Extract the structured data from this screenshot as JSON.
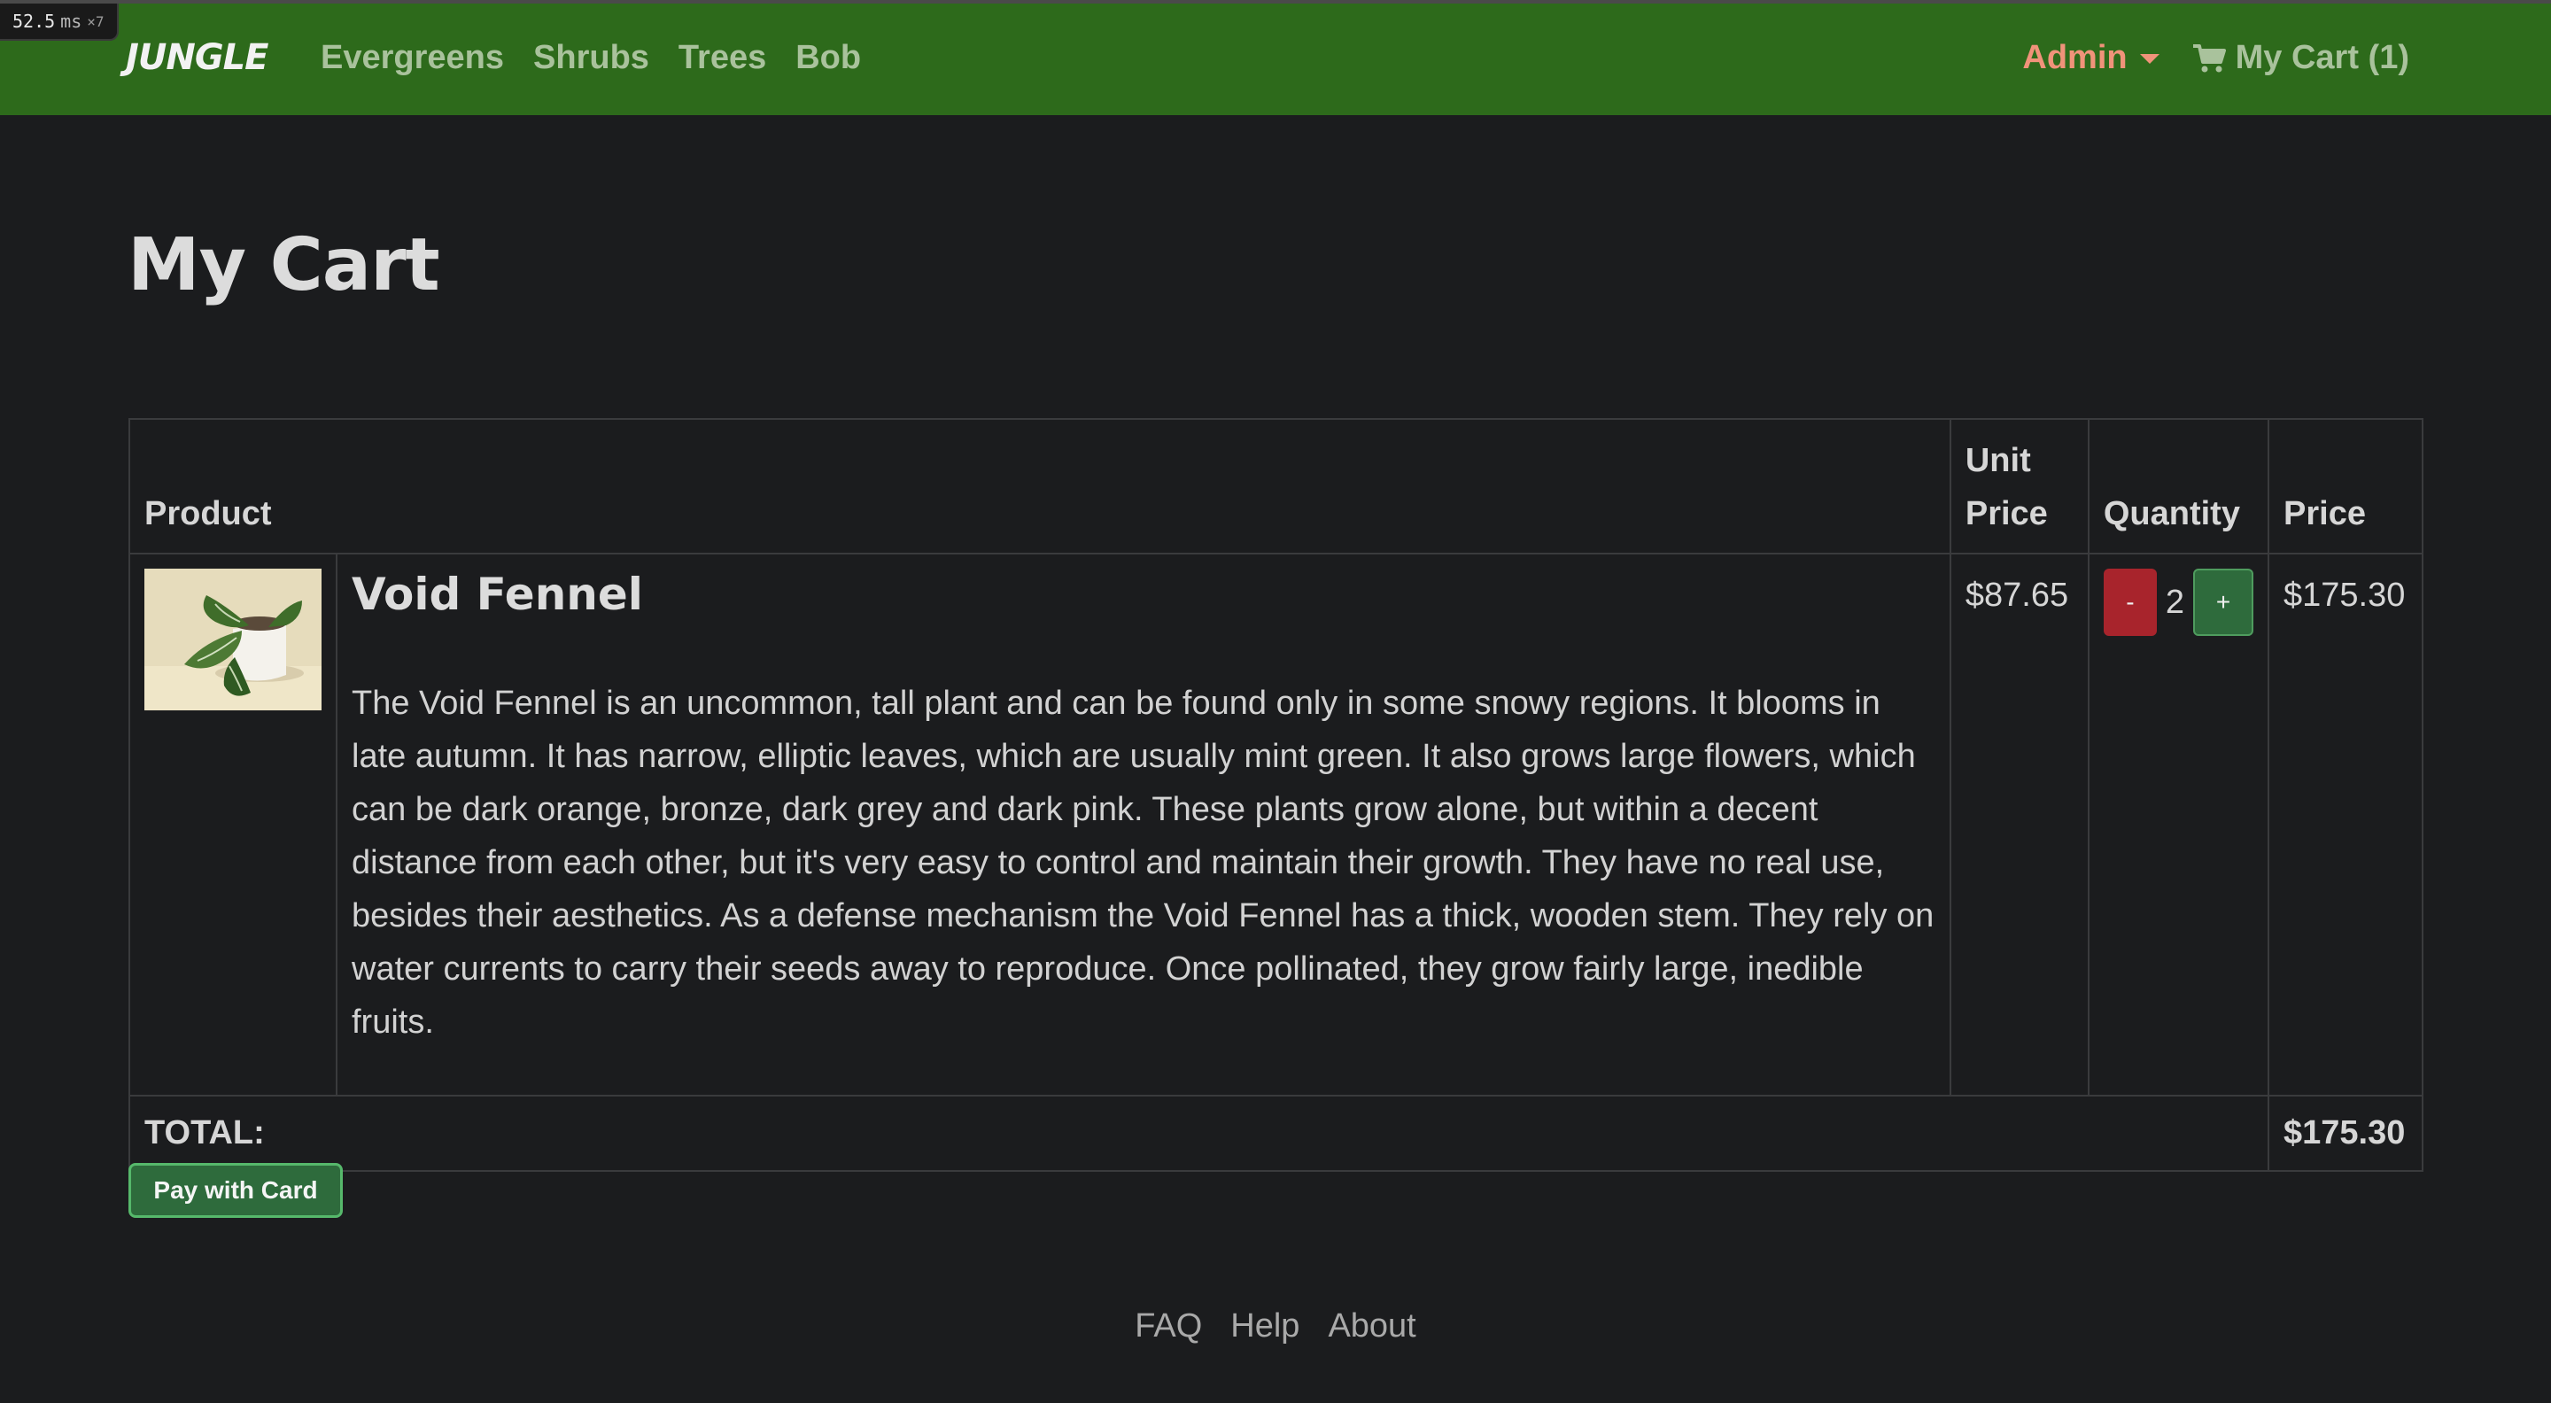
{
  "perf": {
    "value": "52.5",
    "unit": "ms",
    "mult": "×7"
  },
  "navbar": {
    "brand": "JUNGLE",
    "links": [
      "Evergreens",
      "Shrubs",
      "Trees",
      "Bob"
    ],
    "admin_label": "Admin",
    "cart_label": "My Cart (1)",
    "icons": {
      "cart": "shopping-cart-icon",
      "caret": "caret-down-icon"
    },
    "colors": {
      "navbar_bg": "#2d6a1b",
      "admin": "#f0937a",
      "link": "#a9c29c"
    }
  },
  "page": {
    "title": "My Cart"
  },
  "table": {
    "headers": {
      "product": "Product",
      "unit_price": "Unit Price",
      "quantity": "Quantity",
      "price": "Price"
    },
    "items": [
      {
        "name": "Void Fennel",
        "description": "The Void Fennel is an uncommon, tall plant and can be found only in some snowy regions. It blooms in late autumn. It has narrow, elliptic leaves, which are usually mint green. It also grows large flowers, which can be dark orange, bronze, dark grey and dark pink. These plants grow alone, but within a decent distance from each other, but it's very easy to control and maintain their growth. They have no real use, besides their aesthetics. As a defense mechanism the Void Fennel has a thick, wooden stem. They rely on water currents to carry their seeds away to reproduce. Once pollinated, they grow fairly large, inedible fruits.",
        "unit_price": "$87.65",
        "quantity": "2",
        "minus_label": "-",
        "plus_label": "+",
        "price": "$175.30"
      }
    ],
    "total_label": "TOTAL:",
    "total_value": "$175.30"
  },
  "actions": {
    "pay_label": "Pay with Card"
  },
  "footer": {
    "links": [
      "FAQ",
      "Help",
      "About"
    ]
  }
}
